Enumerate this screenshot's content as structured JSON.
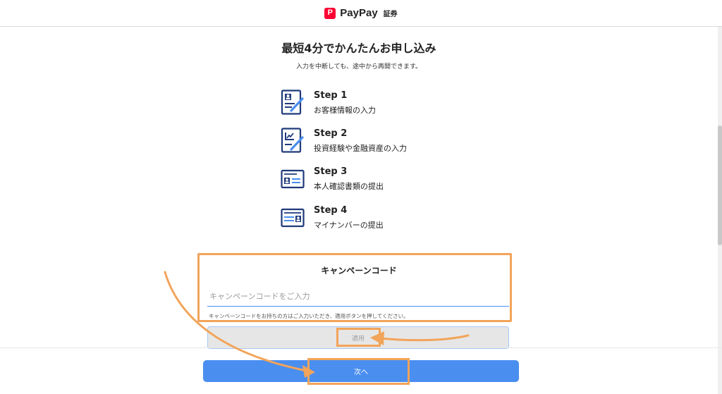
{
  "header": {
    "logo_mark": "P",
    "brand": "PayPay",
    "brand_sub": "証券"
  },
  "main": {
    "title": "最短4分でかんたんお申し込み",
    "subtitle": "入力を中断しても、途中から再開できます。"
  },
  "steps": [
    {
      "title": "Step 1",
      "desc": "お客様情報の入力",
      "icon": "profile-form-icon"
    },
    {
      "title": "Step 2",
      "desc": "投資経験や金融資産の入力",
      "icon": "investment-chart-icon"
    },
    {
      "title": "Step 3",
      "desc": "本人確認書類の提出",
      "icon": "id-card-icon"
    },
    {
      "title": "Step 4",
      "desc": "マイナンバーの提出",
      "icon": "mynumber-card-icon"
    }
  ],
  "campaign": {
    "title": "キャンペーンコード",
    "input_value": "",
    "placeholder": "キャンペーンコードをご入力",
    "help": "キャンペーンコードをお持ちの方はご入力いただき、適用ボタンを押してください。",
    "apply_label": "適用"
  },
  "footer": {
    "next_label": "次へ"
  },
  "colors": {
    "brand_red": "#ff0033",
    "primary_blue": "#4a8ef0",
    "icon_navy": "#1f3a7a",
    "annotation_orange": "#f2a45a",
    "disabled_gray": "#e6e6e6"
  }
}
